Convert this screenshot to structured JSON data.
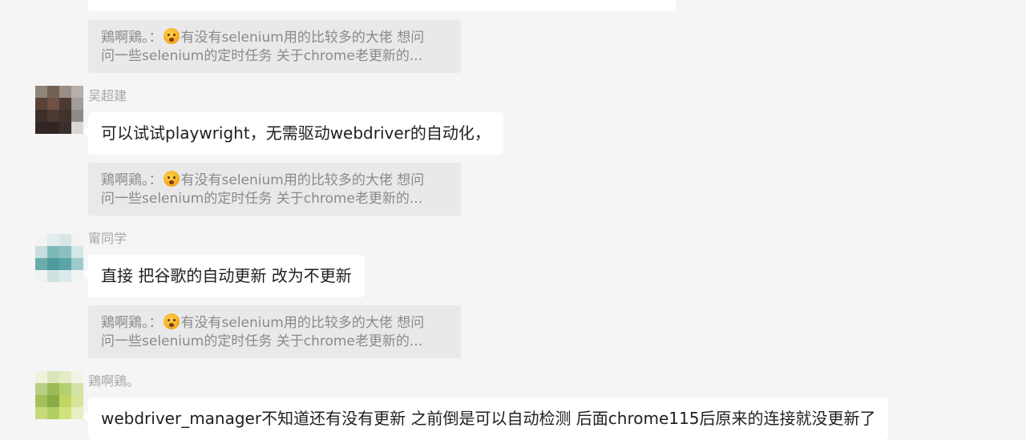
{
  "thread": [
    {
      "type": "quote",
      "line1_prefix": "鶏啊鶏。：",
      "line1_suffix": "有没有selenium用的比较多的大佬  想问",
      "line2": "问一些selenium的定时任务  关于chrome老更新的..."
    },
    {
      "type": "message",
      "sender": "吴超建",
      "text": "可以试试playwright，无需驱动webdriver的自动化，"
    },
    {
      "type": "quote",
      "line1_prefix": "鶏啊鶏。：",
      "line1_suffix": "有没有selenium用的比较多的大佬  想问",
      "line2": "问一些selenium的定时任务  关于chrome老更新的..."
    },
    {
      "type": "message",
      "sender": "甯同学",
      "text": "直接 把谷歌的自动更新 改为不更新"
    },
    {
      "type": "quote",
      "line1_prefix": "鶏啊鶏。：",
      "line1_suffix": "有没有selenium用的比较多的大佬  想问",
      "line2": "问一些selenium的定时任务  关于chrome老更新的..."
    },
    {
      "type": "message",
      "sender": "鶏啊鶏。",
      "text": "webdriver_manager不知道还有没有更新  之前倒是可以自动检测  后面chrome115后原来的连接就没更新了"
    }
  ],
  "icons": {
    "quote_emoji": "hushed-face-emoji-icon",
    "avatars": [
      "pixelated-avatar-dark",
      "pixelated-avatar-teal",
      "pixelated-avatar-green"
    ]
  },
  "colors": {
    "background": "#f5f5f5",
    "bubble": "#ffffff",
    "quote_bg": "#e9e9e9",
    "quote_text": "#8a8a8a",
    "sender_text": "#a6a6a6"
  }
}
